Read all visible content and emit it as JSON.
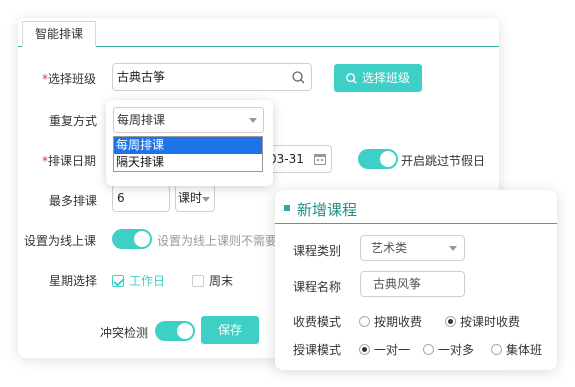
{
  "main": {
    "tab": "智能排课",
    "required_mark": "*",
    "class_label": "选择班级",
    "class_value": "古典古筝",
    "select_class_button": "选择班级",
    "repeat_label": "重复方式",
    "repeat_value": "每周排课",
    "repeat_options": [
      "每周排课",
      "隔天排课"
    ],
    "date_label": "排课日期",
    "date_end_fragment": "03-31",
    "skip_holiday_label": "开启跳过节假日",
    "max_label": "最多排课",
    "max_value": "6",
    "max_unit": "课时",
    "online_label": "设置为线上课",
    "online_hint": "设置为线上课则不需要",
    "weekday_label": "星期选择",
    "weekday_opt": "工作日",
    "weekend_opt": "周末",
    "conflict_label": "冲突检测",
    "save_button": "保存"
  },
  "new_course": {
    "title": "新增课程",
    "category_label": "课程类别",
    "category_value": "艺术类",
    "name_label": "课程名称",
    "name_value": "古典风筝",
    "fee_label": "收费模式",
    "fee_options": [
      "按期收费",
      "按课时收费"
    ],
    "fee_selected": 1,
    "mode_label": "授课模式",
    "mode_options": [
      "一对一",
      "一对多",
      "集体班"
    ],
    "mode_selected": 0
  },
  "colors": {
    "accent": "#3ecfc6",
    "accent_dark": "#31a9a3",
    "option_highlight": "#1e73e8",
    "required": "#e03636"
  }
}
